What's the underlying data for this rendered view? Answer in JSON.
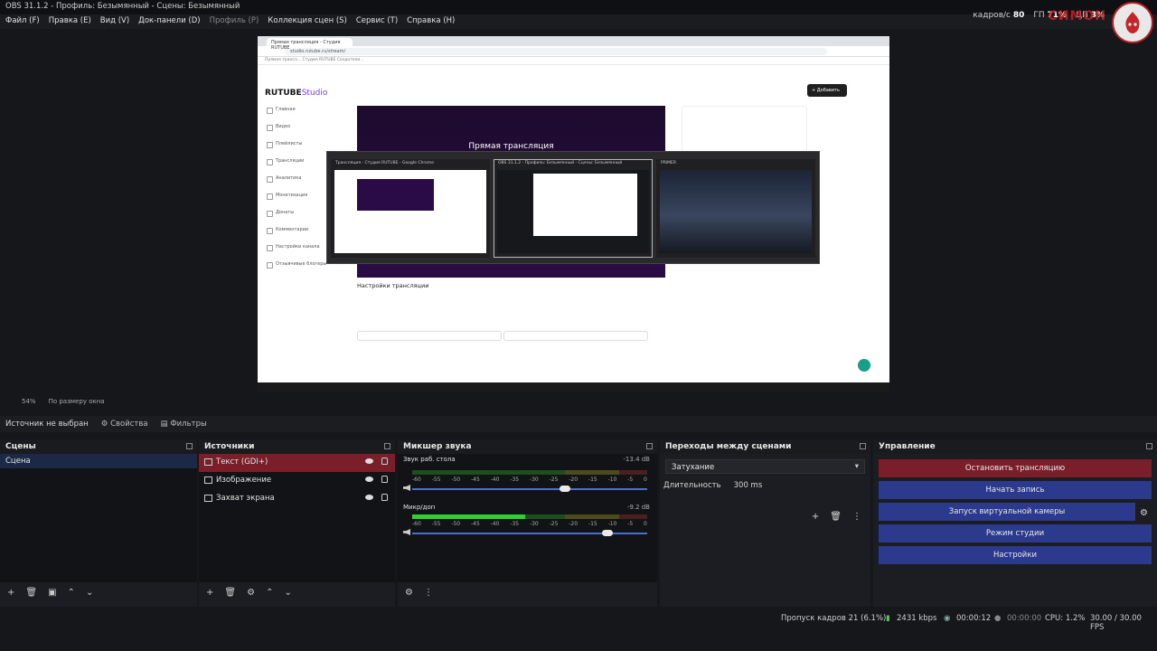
{
  "window": {
    "title": "OBS 31.1.2 - Профиль: Безымянный - Сцены: Безымянный"
  },
  "menu": [
    "Файл (F)",
    "Правка (E)",
    "Вид (V)",
    "Док-панели (D)",
    "Профиль (P)",
    "Коллекция сцен (S)",
    "Сервис (T)",
    "Справка (H)"
  ],
  "stats": {
    "fps_label": "кадров/с",
    "fps_value": "80",
    "gpu_label": "ГП",
    "gpu_value": "71%",
    "cpu_label": "ЦП",
    "cpu_value": "3%"
  },
  "brand": {
    "text": "СИМОН"
  },
  "preview": {
    "browser_tab": "Прямая трансляция - Студия RUTUBE",
    "url": "studio.rutube.ru/stream/",
    "bookmarks": "Прямая трансл...  Студия RUTUBE  Создатели...",
    "logo_a": "RUTUBE",
    "logo_b": "Studio",
    "sidebar": [
      "Главная",
      "Видео",
      "Плейлисты",
      "Трансляции",
      "Аналитика",
      "Монетизация",
      "Донаты",
      "Комментарии",
      "Настройки канала",
      "Отзывчивые блогеры"
    ],
    "add_button": "+ Добавить",
    "video_title": "Прямая трансляция",
    "settings_title": "Настройки трансляции"
  },
  "alttab": [
    {
      "title": "Трансляция - Студия RUTUBE - Google Chrome"
    },
    {
      "title": "OBS 31.1.2 - Профиль: Безымянный - Сцены: Безымянный"
    },
    {
      "title": "PRIMER"
    }
  ],
  "zoom": {
    "value": "54%",
    "mode": "По размеру окна"
  },
  "props": {
    "no_source": "Источник не выбран",
    "properties": "Свойства",
    "filters": "Фильтры"
  },
  "scenes": {
    "title": "Сцены",
    "items": [
      "Сцена"
    ]
  },
  "sources": {
    "title": "Источники",
    "items": [
      "Текст (GDI+)",
      "Изображение",
      "Захват экрана"
    ]
  },
  "mixer": {
    "title": "Микшер звука",
    "channels": [
      {
        "name": "Звук раб. стола",
        "db": "-13.4 dB",
        "level": 0
      },
      {
        "name": "Микр/доп",
        "db": "-9.2 dB",
        "level": 0.48,
        "volume": 0.83
      }
    ],
    "desktop_volume": 0.65,
    "ticks": [
      "-60",
      "-55",
      "-50",
      "-45",
      "-40",
      "-35",
      "-30",
      "-25",
      "-20",
      "-15",
      "-10",
      "-5",
      "0"
    ]
  },
  "transitions": {
    "title": "Переходы между сценами",
    "selected": "Затухание",
    "duration_label": "Длительность",
    "duration_value": "300 ms"
  },
  "controls": {
    "title": "Управление",
    "stop_stream": "Остановить трансляцию",
    "start_record": "Начать запись",
    "virtual_cam": "Запуск виртуальной камеры",
    "studio_mode": "Режим студии",
    "settings": "Настройки"
  },
  "status": {
    "dropped": "Пропуск кадров 21 (6.1%)",
    "bitrate": "2431 kbps",
    "stream_time": "00:00:12",
    "rec_time": "00:00:00",
    "cpu": "CPU: 1.2%",
    "fps": "30.00 / 30.00 FPS"
  },
  "colors": {
    "accent_red": "#7a1f2a",
    "accent_blue": "#2b3a8c"
  }
}
